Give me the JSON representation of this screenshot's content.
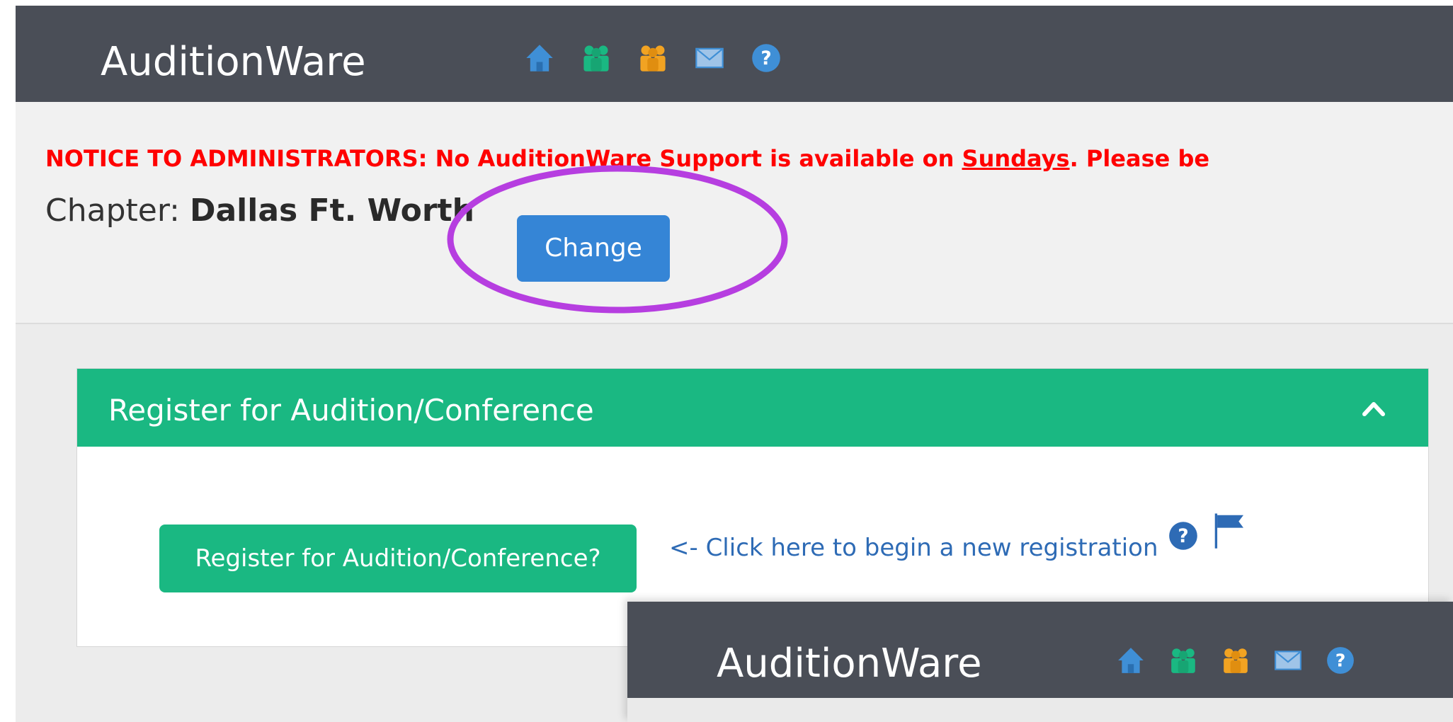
{
  "app": {
    "title": "AuditionWare"
  },
  "navbar": {
    "icons": [
      "home-icon",
      "participants-icon",
      "members-icon",
      "mail-icon",
      "help-icon"
    ]
  },
  "notice": {
    "prefix": "NOTICE TO ADMINISTRATORS:  No AuditionWare Support is available on ",
    "emphasis": "Sundays",
    "suffix": ". Please be "
  },
  "chapter": {
    "label": "Chapter: ",
    "name": "Dallas Ft. Worth",
    "change_label": "Change"
  },
  "panel": {
    "title": "Register for Audition/Conference",
    "register_label": "Register for Audition/Conference?",
    "hint": "<- Click here to begin a new registration"
  },
  "overlay": {
    "title": "AuditionWare"
  },
  "colors": {
    "navbar": "#4a4e57",
    "accent_green": "#1ab882",
    "primary_blue": "#3585d6",
    "notice_red": "#ff0000",
    "highlight": "#b63ee0"
  }
}
